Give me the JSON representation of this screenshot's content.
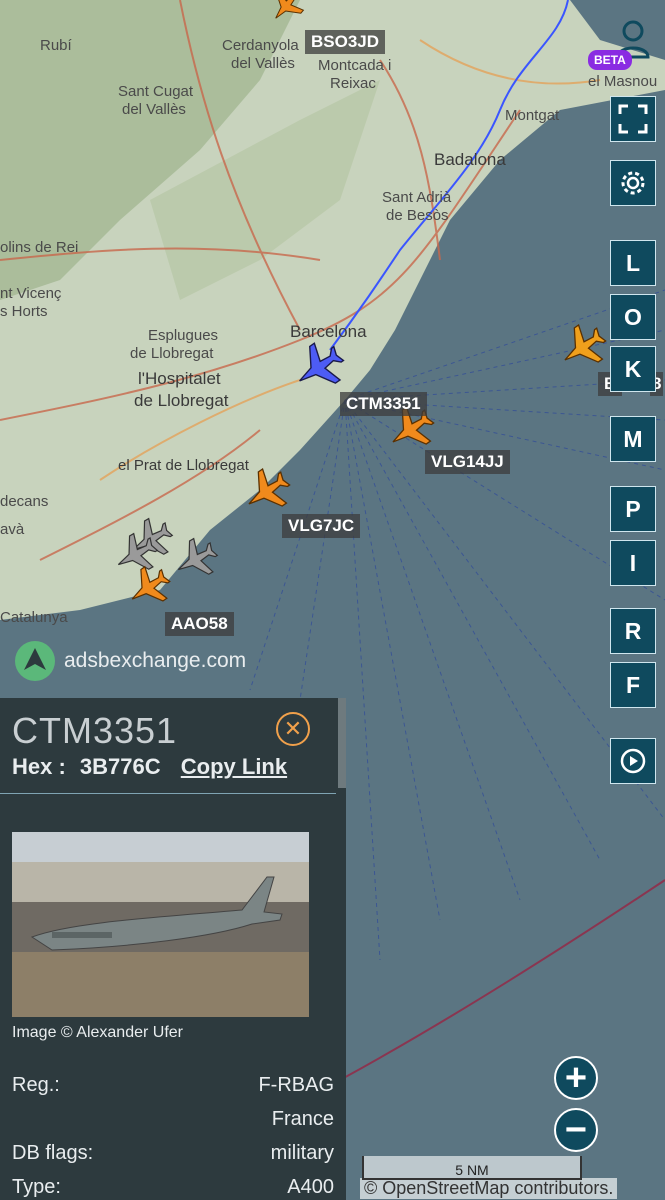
{
  "map": {
    "places": {
      "rubi": "Rubí",
      "cerdanyola": "Cerdanyola",
      "del_valles": "del Vallès",
      "sant_cugat": "Sant Cugat",
      "del_valles2": "del Vallès",
      "montcada": "Montcada i",
      "reixac": "Reixac",
      "montgat": "Montgat",
      "el_masnou": "el Masnou",
      "badalona": "Badalona",
      "sant_adria": "Sant Adrià",
      "de_besos": "de Besòs",
      "molins": "olins de Rei",
      "vicenc": "nt Vicenç",
      "horts": "s Horts",
      "barcelona": "Barcelona",
      "esplugues": "Esplugues",
      "de_llobregat": "de Llobregat",
      "hospitalet": "l'Hospitalet",
      "de_llobregat2": "de Llobregat",
      "prat": "el Prat de Llobregat",
      "decans": "decans",
      "sava": "avà",
      "catalunya": "Catalunya"
    },
    "aircraft_labels": {
      "bso3jd": "BSO3JD",
      "ctm3351": "CTM3351",
      "vlg14jj": "VLG14JJ",
      "vlg7jc": "VLG7JC",
      "aao58": "AAO58",
      "partial": "B",
      "partial2": "8"
    },
    "attribution": "© OpenStreetMap contributors.",
    "scale": "5 NM",
    "logo_text": "adsbexchange.com",
    "beta": "BETA"
  },
  "toolbar": {
    "buttons": [
      "L",
      "O",
      "K",
      "M",
      "P",
      "I",
      "R",
      "F"
    ]
  },
  "panel": {
    "callsign": "CTM3351",
    "hex_label": "Hex :",
    "hex_value": "3B776C",
    "copy_link": "Copy Link",
    "image_credit": "Image © Alexander Ufer",
    "rows": [
      {
        "key": "Reg.:",
        "value": "F-RBAG"
      },
      {
        "key": "",
        "value": "France"
      },
      {
        "key": "DB flags:",
        "value": "military"
      },
      {
        "key": "Type:",
        "value": "A400"
      }
    ]
  },
  "colors": {
    "sea": "#5b7582",
    "land": "#cfd8c6",
    "button_bg": "#0f4a5e",
    "aircraft_orange": "#f08a1c",
    "aircraft_selected": "#4d5cf5",
    "track": "#3a55ff"
  }
}
